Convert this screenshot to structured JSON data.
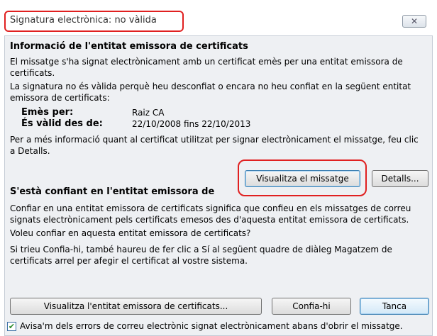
{
  "window": {
    "title": "Signatura electrònica: no vàlida",
    "close_glyph": "✕"
  },
  "issuer_section": {
    "heading": "Informació de l'entitat emissora de certificats",
    "line1": "El missatge s'ha signat electrònicament amb un certificat emès per una entitat emissora de",
    "line2": "certificats.",
    "line3": "La signatura no és vàlida perquè heu desconfiat o encara no heu confiat en la següent entitat",
    "line4": "emissora de certificats:",
    "issued_by_label": "Emès per:",
    "issued_by_value": "Raiz CA",
    "valid_from_label": "És vàlid des de:",
    "valid_from_value": "22/10/2008 fins 22/10/2013",
    "more_info_line1": "Per a més informació quant al certificat utilitzat per signar electrònicament el missatge, feu clic",
    "more_info_line2": "a Detalls."
  },
  "buttons": {
    "view_message": "Visualitza el missatge",
    "details": "Detalls...",
    "view_issuer": "Visualitza l'entitat emissora de certificats...",
    "trust": "Confia-hi",
    "close": "Tanca"
  },
  "trust_section": {
    "heading": "S'està confiant en l'entitat emissora de",
    "line1": "Confiar en una entitat emissora de certificats significa que confieu en els missatges de correu",
    "line2": "signats electrònicament pels certificats emesos des d'aquesta entitat emissora de certificats.",
    "question": "Voleu confiar en aquesta entitat emissora de certificats?",
    "note1": "Si trieu Confia-hi, també haureu de fer clic a Sí al següent quadre de diàleg Magatzem de",
    "note2": "certificats arrel per afegir el certificat al vostre sistema."
  },
  "warn_checkbox": {
    "checked": true,
    "check_glyph": "✔",
    "label": "Avisa'm dels errors de correu electrònic signat electrònicament abans d'obrir el missatge."
  },
  "colors": {
    "highlight": "#e02020",
    "panel_bg": "#eef0f3"
  }
}
